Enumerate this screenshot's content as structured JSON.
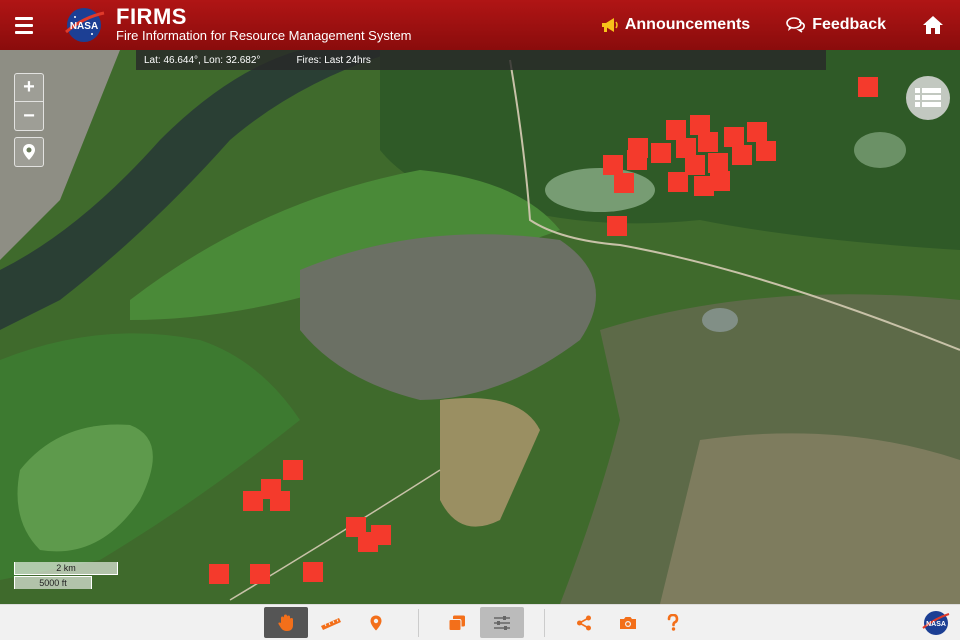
{
  "header": {
    "title": "FIRMS",
    "subtitle": "Fire Information for Resource Management System",
    "logo_text": "NASA",
    "announcements_label": "Announcements",
    "feedback_label": "Feedback"
  },
  "readout": {
    "coords": "Lat: 46.644°, Lon: 32.682°",
    "fires": "Fires: Last 24hrs"
  },
  "map": {
    "zoom_in": "+",
    "zoom_out": "−",
    "scale_km": "2 km",
    "scale_ft": "5000 ft",
    "fire_color": "#f43a2c"
  },
  "toolbar": {
    "accent_color": "#f36f1a",
    "icons": [
      "pan-hand-icon",
      "measure-ruler-icon",
      "marker-icon",
      "layers-icon",
      "settings-sliders-icon",
      "share-icon",
      "camera-icon",
      "help-icon"
    ]
  },
  "colors": {
    "header": "#a51212"
  }
}
